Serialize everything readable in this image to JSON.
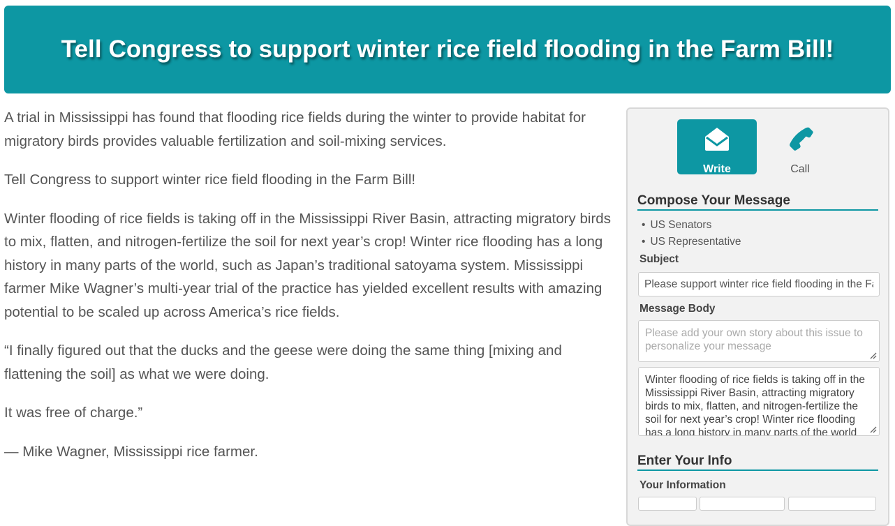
{
  "banner": {
    "title": "Tell Congress to support winter rice field flooding in the Farm Bill!"
  },
  "article": {
    "paragraphs": [
      "A trial in Mississippi has found that flooding rice fields during the winter to provide habitat for migratory birds provides valuable fertilization and soil-mixing services.",
      "Tell Congress to support winter rice field flooding in the Farm Bill!",
      "Winter flooding of rice fields is taking off in the Mississippi River Basin, attracting migratory birds to mix, flatten, and nitrogen-fertilize the soil for next year’s crop! Winter rice flooding has a long history in many parts of the world, such as Japan’s traditional satoyama system. Mississippi farmer Mike Wagner’s multi-year trial of the practice has yielded excellent results with amazing potential to be scaled up across America’s rice fields.",
      "“I finally figured out that the ducks and the geese were doing the same thing [mixing and flattening the soil] as what we were doing.",
      "It was free of charge.”",
      "— Mike Wagner, Mississippi rice farmer."
    ]
  },
  "panel": {
    "modes": {
      "write_label": "Write",
      "write_icon": "envelope-open-icon",
      "call_label": "Call",
      "call_icon": "phone-icon"
    },
    "compose_title": "Compose Your Message",
    "recipients": [
      "US Senators",
      "US Representative"
    ],
    "subject_label": "Subject",
    "subject_value": "Please support winter rice field flooding in the Farm Bill",
    "body_label": "Message Body",
    "story_placeholder": "Please add your own story about this issue to personalize your message",
    "body_text": "Winter flooding of rice fields is taking off in the Mississippi River Basin, attracting migratory birds to mix, flatten, and nitrogen-fertilize the soil for next year’s crop! Winter rice flooding has a long history in many parts of the world",
    "info_title": "Enter Your Info",
    "your_info_label": "Your Information"
  },
  "colors": {
    "accent": "#0d97a3",
    "panel_bg": "#f2f2f2",
    "text": "#555555"
  }
}
